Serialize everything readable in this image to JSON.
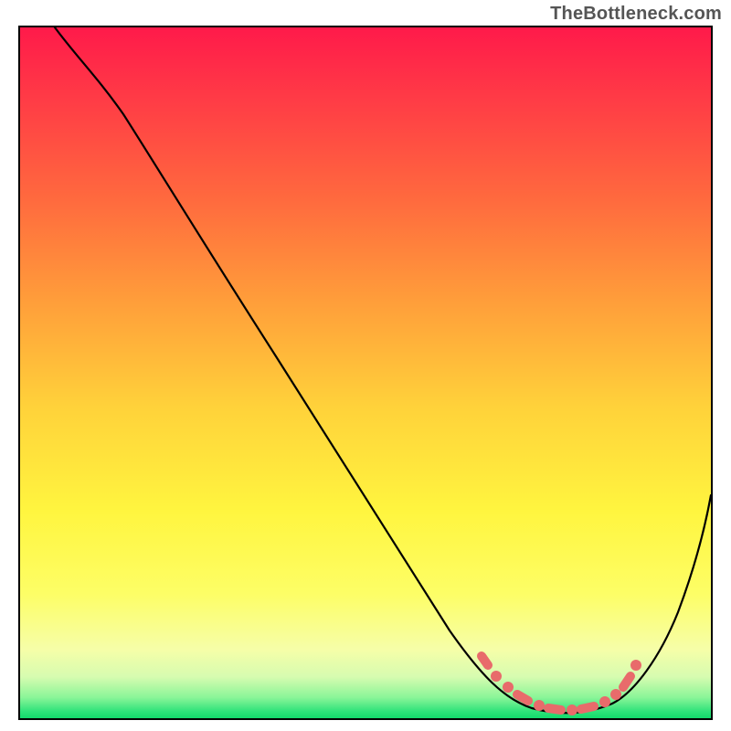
{
  "watermark": "TheBottleneck.com",
  "chart_data": {
    "type": "line",
    "title": "",
    "xlabel": "",
    "ylabel": "",
    "xlim": [
      0,
      100
    ],
    "ylim": [
      0,
      100
    ],
    "background_gradient": {
      "stops": [
        {
          "pos": 0,
          "color": "#ff1a4a"
        },
        {
          "pos": 10,
          "color": "#ff3a46"
        },
        {
          "pos": 25,
          "color": "#ff6a3e"
        },
        {
          "pos": 40,
          "color": "#ff9f3a"
        },
        {
          "pos": 55,
          "color": "#ffd23a"
        },
        {
          "pos": 70,
          "color": "#fff53f"
        },
        {
          "pos": 82,
          "color": "#fdfe66"
        },
        {
          "pos": 90,
          "color": "#f6fea8"
        },
        {
          "pos": 94,
          "color": "#d7fcb0"
        },
        {
          "pos": 97,
          "color": "#8af598"
        },
        {
          "pos": 99,
          "color": "#2fe37a"
        },
        {
          "pos": 100,
          "color": "#13da6c"
        }
      ]
    },
    "series": [
      {
        "name": "bottleneck-curve",
        "x": [
          5,
          10,
          15,
          20,
          30,
          40,
          50,
          55,
          60,
          65,
          70,
          72,
          75,
          78,
          80,
          83,
          85,
          88,
          90,
          95,
          100
        ],
        "y": [
          100,
          97,
          91,
          83,
          68,
          52,
          36,
          28,
          20,
          12,
          6,
          4,
          2,
          1,
          0.5,
          0.5,
          1,
          3,
          7,
          18,
          33
        ]
      }
    ],
    "marker_points": {
      "name": "highlight-dots",
      "x": [
        67,
        69,
        72,
        74.5,
        77,
        79.5,
        82,
        84,
        86,
        87.5,
        89
      ],
      "y": [
        9,
        6,
        4,
        3,
        2.2,
        2,
        2,
        2.5,
        3.5,
        5,
        8
      ],
      "color": "#e86b6b"
    }
  }
}
